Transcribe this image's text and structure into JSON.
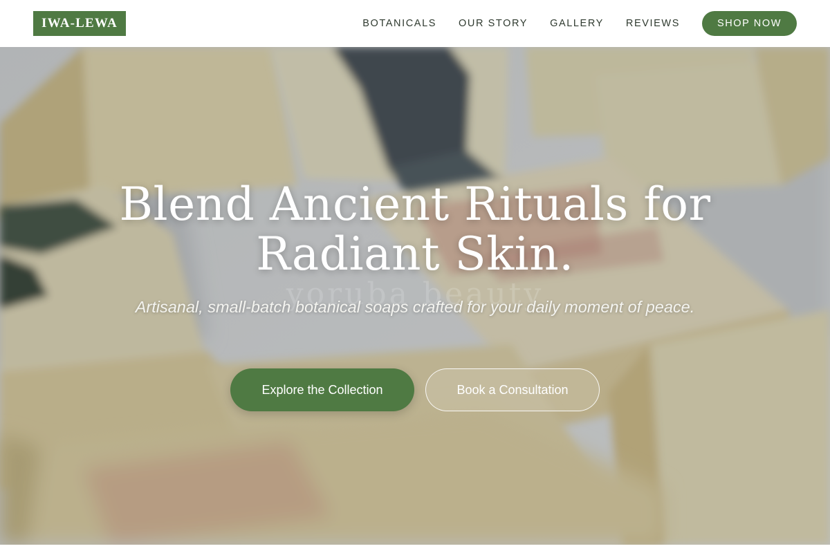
{
  "brand": {
    "logo_text": "IWA-LEWA",
    "accent_color": "#4f7a43"
  },
  "nav": {
    "links": [
      "BOTANICALS",
      "OUR STORY",
      "GALLERY",
      "REVIEWS"
    ],
    "cta_label": "SHOP NOW"
  },
  "hero": {
    "title": "Blend Ancient Rituals for Radiant Skin.",
    "watermark_text": "yoruba beauty",
    "subtitle": "Artisanal, small-batch botanical soaps crafted for your daily moment of peace.",
    "primary_button": "Explore the Collection",
    "secondary_button": "Book a Consultation"
  }
}
